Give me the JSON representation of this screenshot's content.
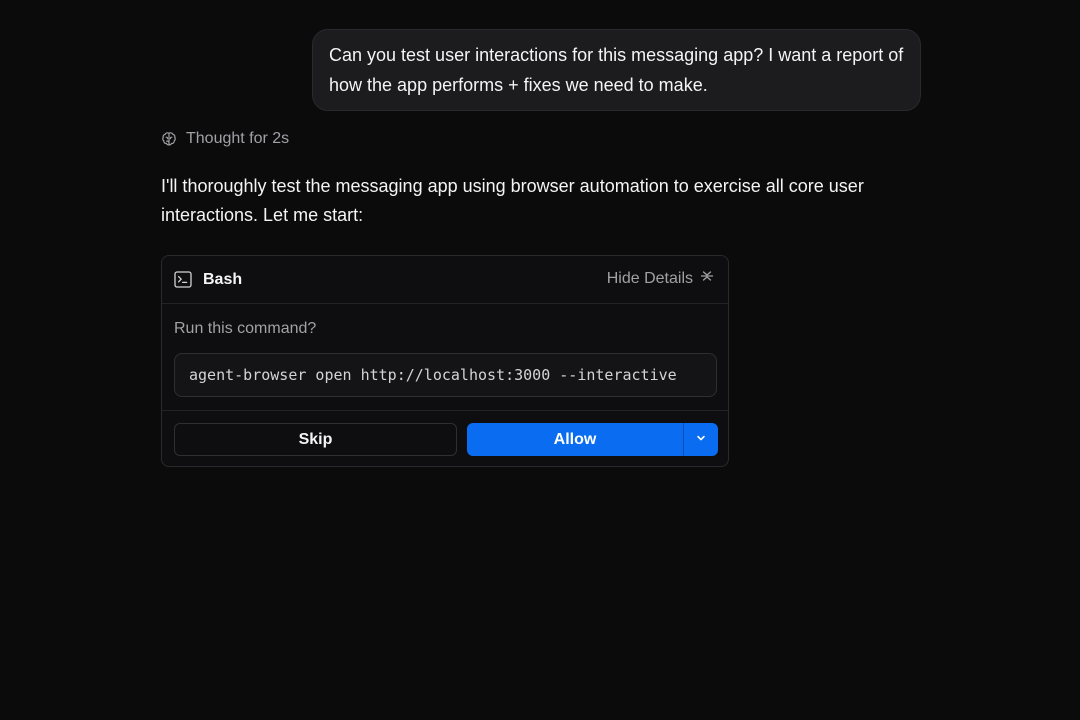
{
  "conversation": {
    "user_message": "Can you test user interactions for this messaging app? I want a report of how the app performs + fixes we need to make.",
    "thought_label": "Thought for 2s",
    "assistant_message": "I'll thoroughly test the messaging app using browser automation to exercise all core user interactions. Let me start:"
  },
  "tool_card": {
    "title": "Bash",
    "hide_details_label": "Hide Details",
    "prompt": "Run this command?",
    "command": "agent-browser open http://localhost:3000 --interactive",
    "skip_label": "Skip",
    "allow_label": "Allow"
  },
  "icons": {
    "thought": "brain-icon",
    "tool": "terminal-icon",
    "hide_details": "collapse-icon",
    "dropdown": "chevron-down-icon"
  },
  "colors": {
    "background": "#0b0b0c",
    "accent": "#0a6cf0",
    "muted_text": "#a1a1a6"
  }
}
